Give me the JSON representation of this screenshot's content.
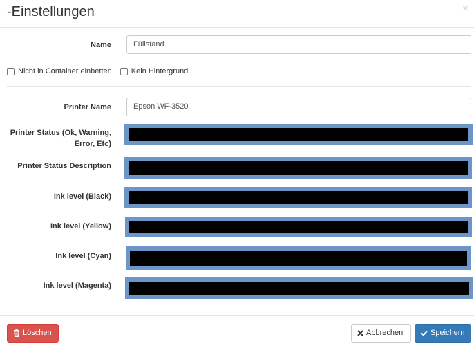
{
  "dialog": {
    "title": "-Einstellungen",
    "close_glyph": "×"
  },
  "fields": {
    "name": {
      "label": "Name",
      "value": "Füllstand"
    },
    "not_in_container": {
      "label": "Nicht in Container einbetten",
      "checked": false
    },
    "no_background": {
      "label": "Kein Hintergrund",
      "checked": false
    },
    "printer_name": {
      "label": "Printer Name",
      "value": "Epson WF-3520"
    },
    "printer_status_line1": "Printer Status (Ok, Warning,",
    "printer_status_line2": "Error, Etc)",
    "printer_status_description": {
      "label": "Printer Status Description"
    },
    "ink_black": {
      "label": "Ink level (Black)"
    },
    "ink_yellow": {
      "label": "Ink level (Yellow)"
    },
    "ink_cyan": {
      "label": "Ink level (Cyan)"
    },
    "ink_magenta": {
      "label": "Ink level (Magenta)"
    }
  },
  "footer": {
    "delete_label": "Löschen",
    "delete_icon": "trash-icon",
    "cancel_label": "Abbrechen",
    "cancel_icon": "x-icon",
    "save_label": "Speichern",
    "save_icon": "check-icon"
  },
  "colors": {
    "redaction_border": "#6d95c7",
    "danger": "#d9534f",
    "primary": "#337ab7"
  }
}
